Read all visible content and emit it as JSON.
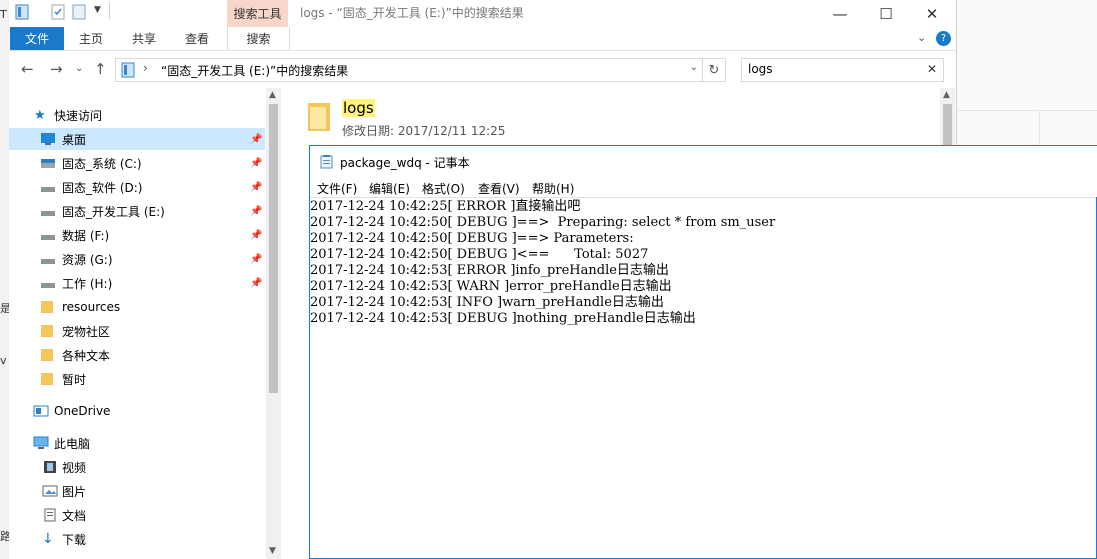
{
  "background_fragments": [
    "T",
    "是",
    "v",
    "路"
  ],
  "explorer": {
    "window_title": "logs - “固态_开发工具 (E:)”中的搜索结果",
    "context_tab_header": "搜索工具",
    "caption_buttons": {
      "minimize": "—",
      "maximize": "☐",
      "close": "✕"
    },
    "ribbon_tabs": [
      "文件",
      "主页",
      "共享",
      "查看",
      "搜索"
    ],
    "address": {
      "path": "“固态_开发工具 (E:)”中的搜索结果",
      "separator": "›"
    },
    "search": {
      "value": "logs",
      "clear": "✕"
    },
    "nav": {
      "quick_access": "快速访问",
      "items": [
        {
          "label": "桌面",
          "icon": "desktop-icon",
          "pinned": true
        },
        {
          "label": "固态_系统 (C:)",
          "icon": "drive-icon",
          "pinned": true
        },
        {
          "label": "固态_软件 (D:)",
          "icon": "drive-icon",
          "pinned": true
        },
        {
          "label": "固态_开发工具 (E:)",
          "icon": "drive-icon",
          "pinned": true
        },
        {
          "label": "数据 (F:)",
          "icon": "drive-icon",
          "pinned": true
        },
        {
          "label": "资源 (G:)",
          "icon": "drive-icon",
          "pinned": true
        },
        {
          "label": "工作 (H:)",
          "icon": "drive-icon",
          "pinned": true
        },
        {
          "label": "resources",
          "icon": "folder-icon",
          "pinned": false
        },
        {
          "label": "宠物社区",
          "icon": "folder-icon",
          "pinned": false
        },
        {
          "label": "各种文本",
          "icon": "folder-icon",
          "pinned": false
        },
        {
          "label": "暂时",
          "icon": "folder-icon",
          "pinned": false
        }
      ],
      "onedrive": "OneDrive",
      "this_pc": "此电脑",
      "pc_items": [
        "视频",
        "图片",
        "文档",
        "下载"
      ]
    },
    "result": {
      "name": "logs",
      "modified_label": "修改日期:",
      "modified_value": "2017/12/11 12:25"
    }
  },
  "notepad": {
    "title": "package_wdq - 记事本",
    "menus": [
      "文件(F)",
      "编辑(E)",
      "格式(O)",
      "查看(V)",
      "帮助(H)"
    ],
    "lines": [
      "2017-12-24 10:42:25[ ERROR ]直接输出吧",
      "2017-12-24 10:42:50[ DEBUG ]==>  Preparing: select * from sm_user",
      "2017-12-24 10:42:50[ DEBUG ]==> Parameters: ",
      "2017-12-24 10:42:50[ DEBUG ]<==      Total: 5027",
      "2017-12-24 10:42:53[ ERROR ]info_preHandle日志输出",
      "2017-12-24 10:42:53[ WARN ]error_preHandle日志输出",
      "2017-12-24 10:42:53[ INFO ]warn_preHandle日志输出",
      "2017-12-24 10:42:53[ DEBUG ]nothing_preHandle日志输出"
    ]
  },
  "colors": {
    "accent": "#1979ca",
    "context_tab": "#f8d6c9",
    "selected_nav": "#cce8ff",
    "search_highlight": "#fff37a",
    "folder": "#f5c659"
  }
}
